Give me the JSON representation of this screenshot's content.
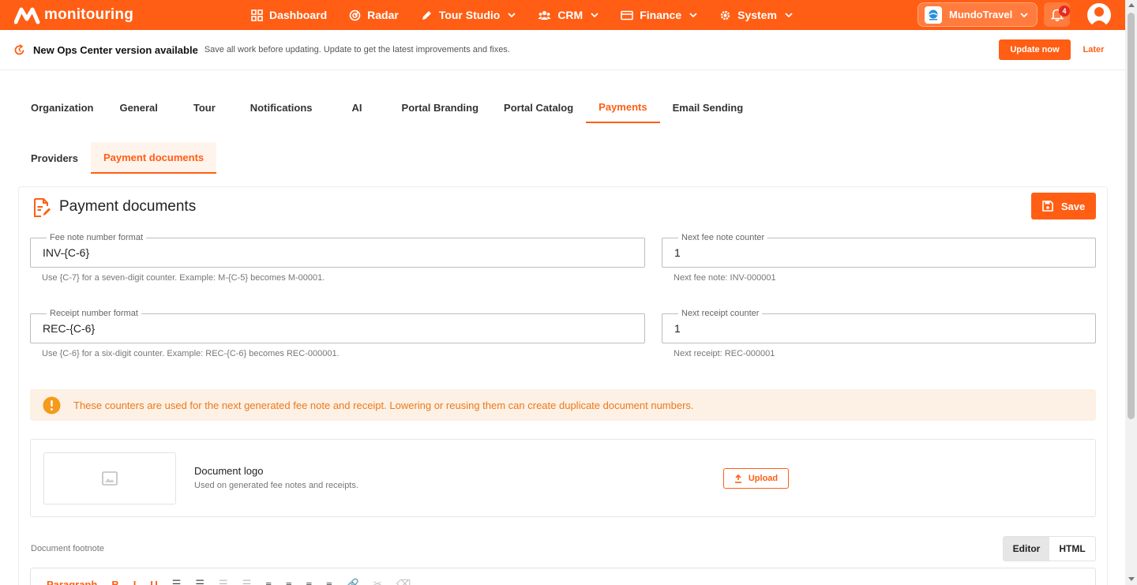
{
  "app": {
    "brand": "monitouring"
  },
  "nav": {
    "items": [
      {
        "label": "Dashboard",
        "icon": "grid-icon",
        "has_menu": false
      },
      {
        "label": "Radar",
        "icon": "radar-icon",
        "has_menu": false
      },
      {
        "label": "Tour Studio",
        "icon": "pen-icon",
        "has_menu": true
      },
      {
        "label": "CRM",
        "icon": "users-icon",
        "has_menu": true
      },
      {
        "label": "Finance",
        "icon": "card-icon",
        "has_menu": true
      },
      {
        "label": "System",
        "icon": "gear-icon",
        "has_menu": true
      }
    ],
    "tenant": "MundoTravel",
    "notification_count": "4"
  },
  "banner": {
    "title": "New Ops Center version available",
    "text": "Save all work before updating. Update to get the latest improvements and fixes.",
    "update_label": "Update now",
    "later_label": "Later"
  },
  "tabs": [
    "Organization",
    "General",
    "Tour",
    "Notifications",
    "AI",
    "Portal Branding",
    "Portal Catalog",
    "Payments",
    "Email Sending"
  ],
  "active_tab": "Payments",
  "subtabs": [
    "Providers",
    "Payment documents"
  ],
  "active_subtab": "Payment documents",
  "card": {
    "title": "Payment documents",
    "save_label": "Save",
    "fields": {
      "fee_format": {
        "label": "Fee note number format",
        "value": "INV-{C-6}",
        "hint": "Use {C-7} for a seven-digit counter. Example: M-{C-5} becomes M-00001."
      },
      "fee_counter": {
        "label": "Next fee note counter",
        "value": "1",
        "hint": "Next fee note: INV-000001"
      },
      "receipt_format": {
        "label": "Receipt number format",
        "value": "REC-{C-6}",
        "hint": "Use {C-6} for a six-digit counter. Example: REC-{C-6} becomes REC-000001."
      },
      "receipt_counter": {
        "label": "Next receipt counter",
        "value": "1",
        "hint": "Next receipt: REC-000001"
      }
    },
    "warning": "These counters are used for the next generated fee note and receipt. Lowering or reusing them can create duplicate document numbers.",
    "logo": {
      "title": "Document logo",
      "subtitle": "Used on generated fee notes and receipts.",
      "upload_label": "Upload"
    },
    "footnote": {
      "label": "Document footnote",
      "editor_label": "Editor",
      "html_label": "HTML",
      "format_label": "Paragraph"
    }
  },
  "colors": {
    "accent": "#ff5e14",
    "warning_bg": "#fdf0e4",
    "warning_text": "#ec7a1c"
  }
}
